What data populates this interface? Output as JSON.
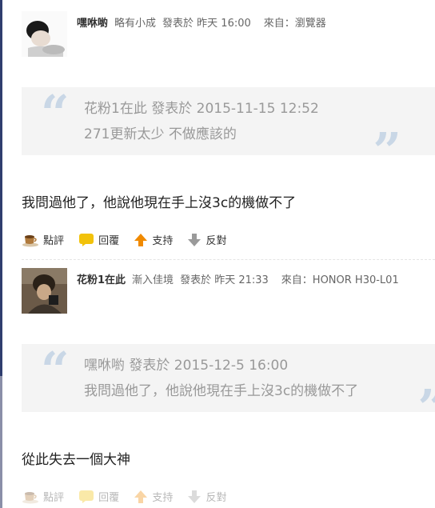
{
  "post1": {
    "user": "嘿咻喲",
    "level": "略有小成",
    "posted": "發表於 昨天 16:00",
    "source": "來自：瀏覽器",
    "quote": {
      "author_line": "花粉1在此 發表於 2015-11-15 12:52",
      "text": "271更新太少  不做應該的"
    },
    "body": "我問過他了，他說他現在手上沒3c的機做不了",
    "actions": [
      "點評",
      "回覆",
      "支持",
      "反對"
    ]
  },
  "post2": {
    "user": "花粉1在此",
    "level": "漸入佳境",
    "posted": "發表於 昨天 21:33",
    "source": "來自：HONOR H30-L01",
    "quote": {
      "author_line": "嘿咻喲 發表於 2015-12-5 16:00",
      "text": "我問過他了，他說他現在手上沒3c的機做不了"
    },
    "body": "從此失去一個大神",
    "actions": [
      "點評",
      "回覆",
      "支持",
      "反對"
    ]
  }
}
